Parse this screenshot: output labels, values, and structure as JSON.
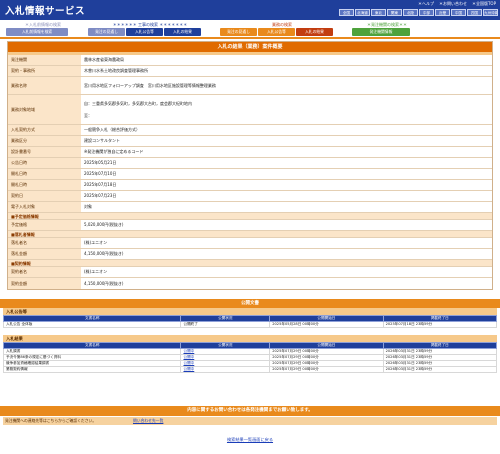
{
  "header": {
    "site_title": "入札情報サービス",
    "help_links": [
      "＊ヘルプ",
      "＊お問い合わせ",
      "＊全国版TOP"
    ],
    "regions": [
      "全国",
      "北海道",
      "東北",
      "関東",
      "北陸",
      "中部",
      "近畿",
      "中国",
      "四国",
      "九州沖縄"
    ]
  },
  "nav": {
    "groups": [
      {
        "title": "＊入札前情報の検索",
        "buttons": [
          "入札前情報を検索"
        ]
      },
      {
        "title": "＊＊＊＊＊＊ 工事の検索 ＊＊＊＊＊＊＊",
        "buttons": [
          "発注の見通し",
          "入札公告等",
          "入札の結果"
        ]
      },
      {
        "title": "業務の検索",
        "buttons": [
          "発注の見通し",
          "入札公告等",
          "入札の結果"
        ]
      },
      {
        "title": "＊発注機関の検索＊＊",
        "buttons": [
          "発注機関情報"
        ]
      }
    ]
  },
  "main": {
    "title": "入札の結果（業務）案件概要",
    "rows": [
      {
        "label": "発注機関",
        "value": "農林水産省東海農政局"
      },
      {
        "label": "契約・事務所",
        "value": "木曽川水系土地改良調査管理事務所"
      },
      {
        "label": "業務名称",
        "value": "宮川用水地区フォローアップ調査　宮川用水地区施設管理等情報整理業務"
      },
      {
        "label": "業務対象地域",
        "value": "自：三重県多気郡多気町，多気郡大台町，度会郡大紀町地内",
        "value2": "至："
      },
      {
        "label": "入札契約方式",
        "value": "一般競争入札（総合評価方式）"
      },
      {
        "label": "業務区分",
        "value": "建設コンサルタント"
      },
      {
        "label": "設計書番号",
        "value": "※発注機関が独自に定めるコード"
      },
      {
        "label": "公告日時",
        "value": "2025年05月21日"
      },
      {
        "label": "開札日時",
        "value": "2025年07月10日"
      },
      {
        "label": "開札日時",
        "value": "2025年07月18日"
      },
      {
        "label": "契約日",
        "value": "2025年07月23日"
      },
      {
        "label": "電子入札対象",
        "value": "対象"
      }
    ],
    "sections": {
      "budget": "■予定価格情報",
      "winner": "■落札者情報",
      "contract": "■契約情報"
    },
    "budget_rows": [
      {
        "label": "予定価格",
        "value": "5,020,000円(税抜き)"
      }
    ],
    "winner_rows": [
      {
        "label": "落札者名",
        "value": "(株)ユニオン"
      },
      {
        "label": "落札金額",
        "value": "4,150,000円(税抜き)"
      }
    ],
    "contract_rows": [
      {
        "label": "契約者名",
        "value": "(株)ユニオン"
      },
      {
        "label": "契約金額",
        "value": "4,150,000円(税抜き)"
      }
    ]
  },
  "docs": {
    "title": "公開文書",
    "columns": [
      "文書名称",
      "公開状況",
      "公開開始日",
      "掲載終了日"
    ],
    "notice": {
      "heading": "入札公告等",
      "rows": [
        [
          "入札公告 全体版",
          "公開終了",
          "2025年05月28日 00時00分",
          "2025年07月18日 23時59分"
        ]
      ]
    },
    "result": {
      "heading": "入札結果",
      "rows": [
        [
          "入札調書",
          "公開中",
          "2025年07月29日 00時00分",
          "2026年03月31日 23時59分"
        ],
        [
          "予決令第86条の規定に基づく資料",
          "公開中",
          "2025年07月29日 00時00分",
          "2026年03月31日 23時59分"
        ],
        [
          "競争参加資格確認結果調書",
          "公開中",
          "2025年07月29日 00時00分",
          "2026年03月31日 23時59分"
        ],
        [
          "業務契約情報",
          "公開中",
          "2025年07月29日 00時00分",
          "2026年03月31日 23時59分"
        ]
      ]
    }
  },
  "inquiry": {
    "title": "内容に関するお問い合わせは各発注機関までお願い致します。",
    "label": "発注機関への連絡先等はこちらからご確認ください。",
    "link": "問い合わせ先一覧"
  },
  "return_link": "検索結果一覧画面に戻る"
}
